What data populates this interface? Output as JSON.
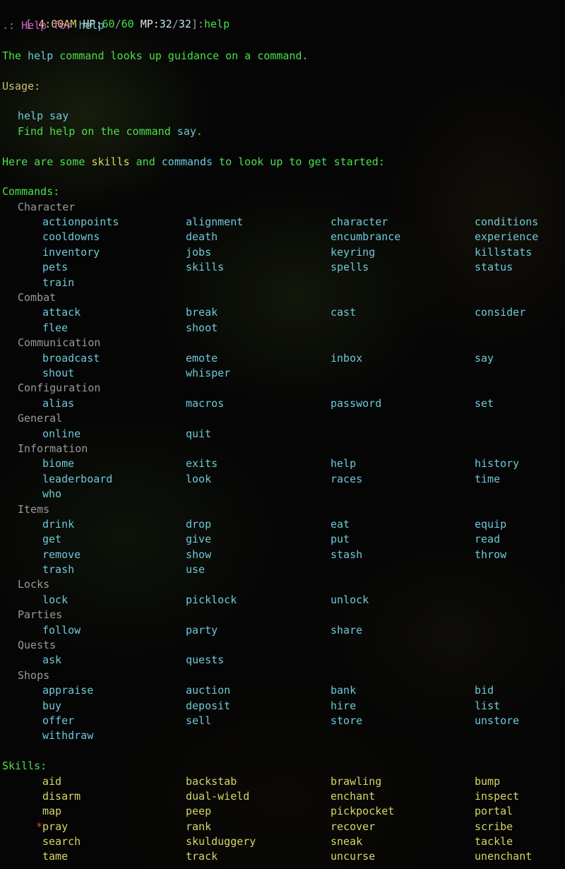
{
  "statusbar": {
    "bracket_open": "[",
    "time_icon": "☀",
    "time": "4:00AM",
    "hp_label": "HP:",
    "hp_value": "60",
    "hp_sep": "/",
    "hp_max": "60",
    "mp_label": "MP:",
    "mp_value": "32",
    "mp_sep": "/",
    "mp_max": "32",
    "bracket_close": "]",
    "prompt_sep": ":",
    "command": "help",
    "colors": {
      "hp": "#4ae04a",
      "mp": "#bfe8f0",
      "command": "#4ae04a",
      "bracket": "#9a9a9a",
      "time": "#d6d66a"
    }
  },
  "echo_line": {
    "prefix": ".:",
    "title": "Help for",
    "topic": "help"
  },
  "intro": {
    "desc_pre": "The ",
    "desc_cmd": "help",
    "desc_post": " command looks up guidance on a command.",
    "usage_label": "Usage:",
    "usage_example": "help say",
    "usage_explain_pre": "Find help on the command ",
    "usage_explain_cmd": "say",
    "usage_explain_post": ".",
    "lead_pre": "Here are some ",
    "lead_skills": "skills",
    "lead_mid": " and ",
    "lead_commands": "commands",
    "lead_post": " to look up to get started:"
  },
  "commands": {
    "header": "Commands:",
    "categories": [
      {
        "name": "Character",
        "rows": [
          [
            "actionpoints",
            "alignment",
            "character",
            "conditions"
          ],
          [
            "cooldowns",
            "death",
            "encumbrance",
            "experience"
          ],
          [
            "inventory",
            "jobs",
            "keyring",
            "killstats"
          ],
          [
            "pets",
            "skills",
            "spells",
            "status"
          ],
          [
            "train",
            "",
            "",
            ""
          ]
        ]
      },
      {
        "name": "Combat",
        "rows": [
          [
            "attack",
            "break",
            "cast",
            "consider"
          ],
          [
            "flee",
            "shoot",
            "",
            ""
          ]
        ]
      },
      {
        "name": "Communication",
        "rows": [
          [
            "broadcast",
            "emote",
            "inbox",
            "say"
          ],
          [
            "shout",
            "whisper",
            "",
            ""
          ]
        ]
      },
      {
        "name": "Configuration",
        "rows": [
          [
            "alias",
            "macros",
            "password",
            "set"
          ]
        ]
      },
      {
        "name": "General",
        "rows": [
          [
            "online",
            "quit",
            "",
            ""
          ]
        ]
      },
      {
        "name": "Information",
        "rows": [
          [
            "biome",
            "exits",
            "help",
            "history"
          ],
          [
            "leaderboard",
            "look",
            "races",
            "time"
          ],
          [
            "who",
            "",
            "",
            ""
          ]
        ]
      },
      {
        "name": "Items",
        "rows": [
          [
            "drink",
            "drop",
            "eat",
            "equip"
          ],
          [
            "get",
            "give",
            "put",
            "read"
          ],
          [
            "remove",
            "show",
            "stash",
            "throw"
          ],
          [
            "trash",
            "use",
            "",
            ""
          ]
        ]
      },
      {
        "name": "Locks",
        "rows": [
          [
            "lock",
            "picklock",
            "unlock",
            ""
          ]
        ]
      },
      {
        "name": "Parties",
        "rows": [
          [
            "follow",
            "party",
            "share",
            ""
          ]
        ]
      },
      {
        "name": "Quests",
        "rows": [
          [
            "ask",
            "quests",
            "",
            ""
          ]
        ]
      },
      {
        "name": "Shops",
        "rows": [
          [
            "appraise",
            "auction",
            "bank",
            "bid"
          ],
          [
            "buy",
            "deposit",
            "hire",
            "list"
          ],
          [
            "offer",
            "sell",
            "store",
            "unstore"
          ],
          [
            "withdraw",
            "",
            "",
            ""
          ]
        ]
      }
    ]
  },
  "skills": {
    "header": "Skills:",
    "star_marker": "*",
    "starred": [
      "pray"
    ],
    "rows": [
      [
        "aid",
        "backstab",
        "brawling",
        "bump"
      ],
      [
        "disarm",
        "dual-wield",
        "enchant",
        "inspect"
      ],
      [
        "map",
        "peep",
        "pickpocket",
        "portal"
      ],
      [
        "pray",
        "rank",
        "recover",
        "scribe"
      ],
      [
        "search",
        "skulduggery",
        "sneak",
        "tackle"
      ],
      [
        "tame",
        "track",
        "uncurse",
        "unenchant"
      ]
    ]
  }
}
